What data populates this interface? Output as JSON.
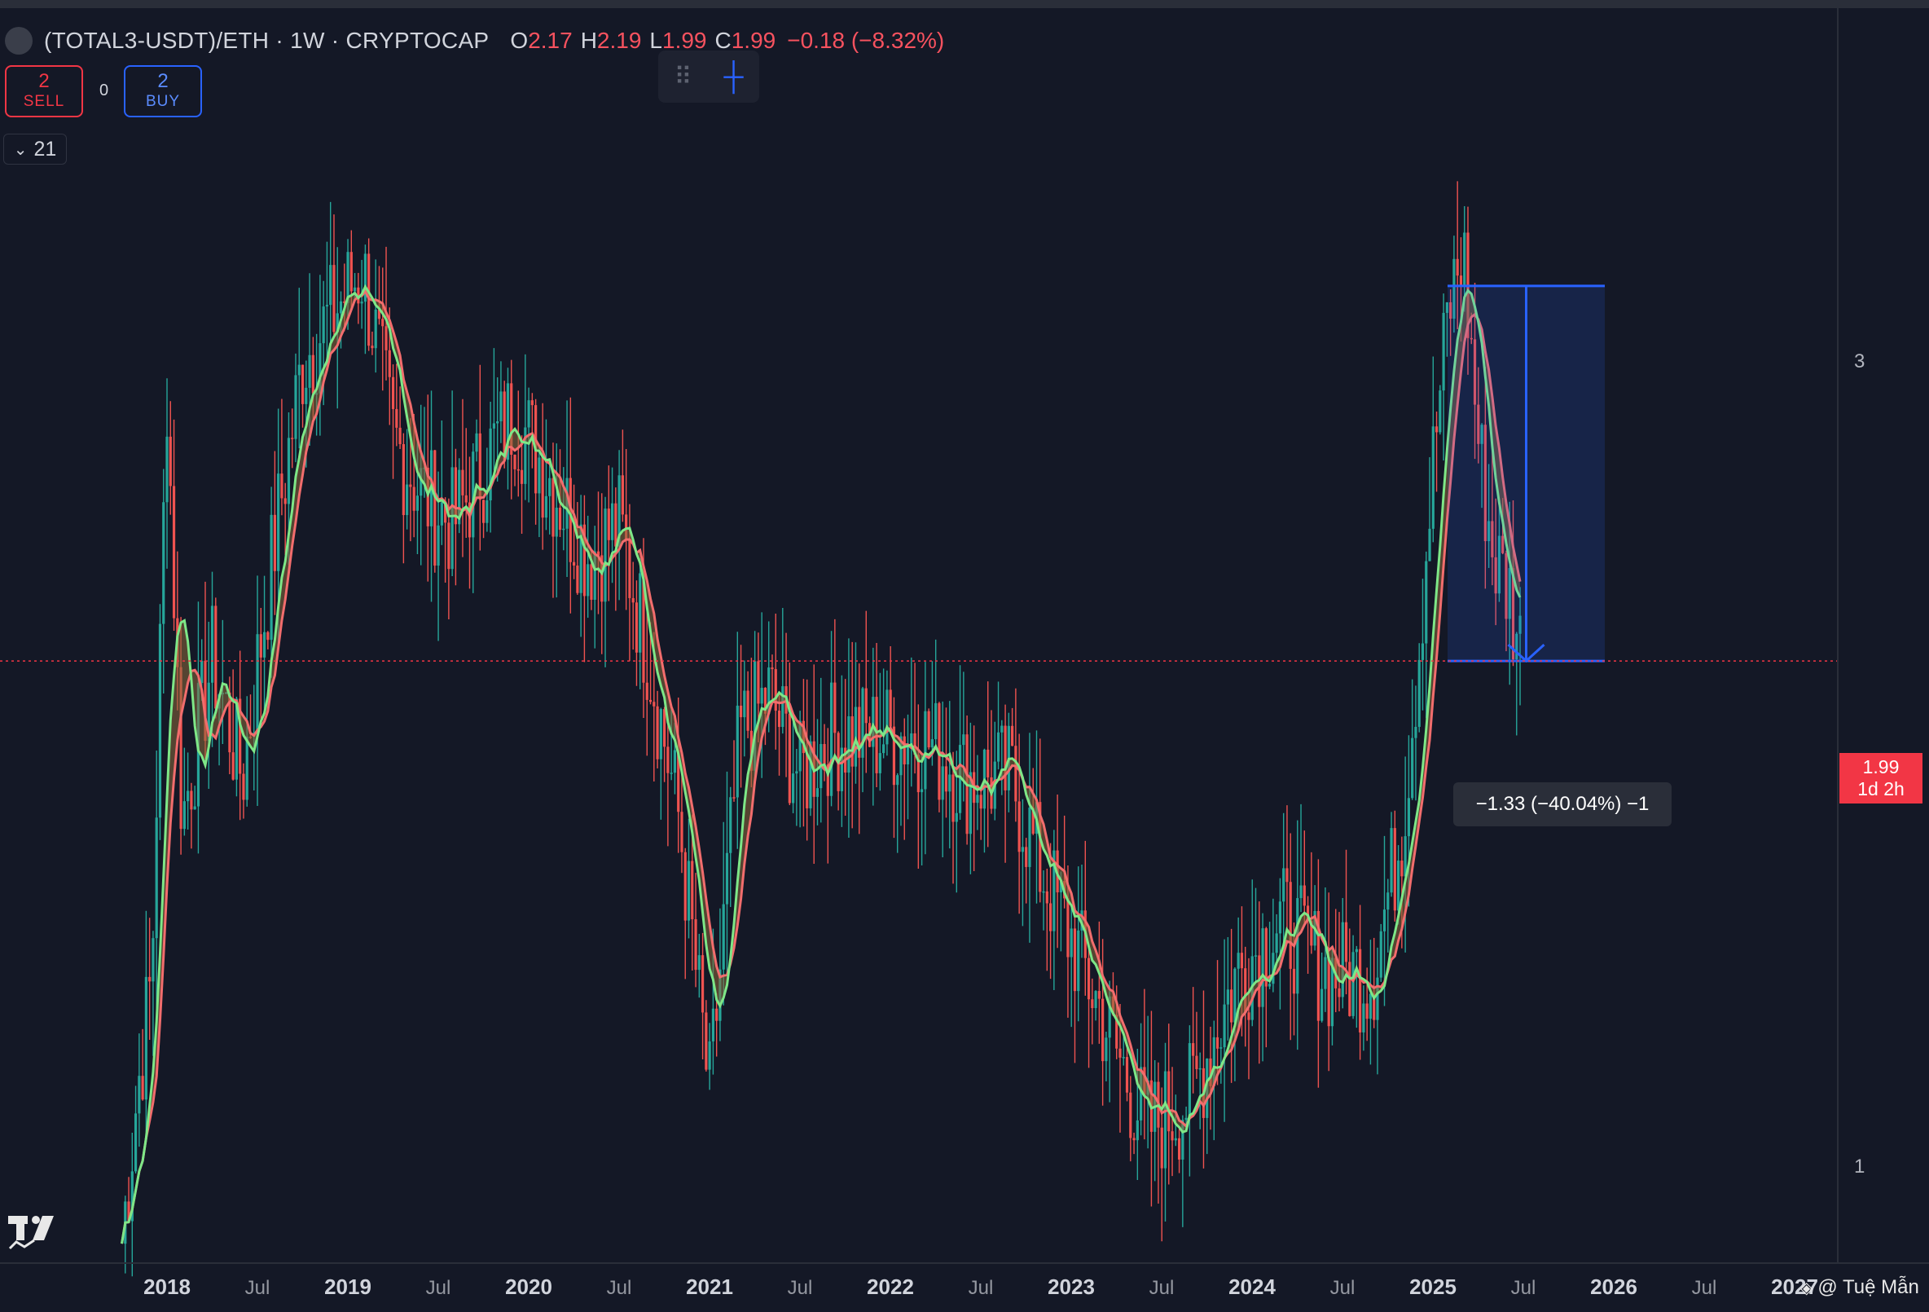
{
  "legend": {
    "symbol": "(TOTAL3-USDT)/ETH · 1W · CRYPTOCAP",
    "open_label": "O",
    "open": "2.17",
    "high_label": "H",
    "high": "2.19",
    "low_label": "L",
    "low": "1.99",
    "close_label": "C",
    "close": "1.99",
    "change": "−0.18 (−8.32%)"
  },
  "trade": {
    "sell_count": "2",
    "sell_label": "SELL",
    "spread": "0",
    "buy_count": "2",
    "buy_label": "BUY"
  },
  "indicators_collapsed": {
    "count": "21"
  },
  "price_tag": {
    "price": "1.99",
    "countdown": "1d 2h"
  },
  "measure": {
    "label": "−1.33 (−40.04%) −1"
  },
  "watermark": {
    "text": "@ Tuệ Mẫn"
  },
  "colors": {
    "background": "#141826",
    "up": "#26a69a",
    "down": "#ef5350",
    "ma_fast": "#7ee787",
    "ma_slow": "#f26d6d",
    "measure": "#2962ff",
    "price_line": "#f23645"
  },
  "chart_data": {
    "type": "candlestick",
    "timeframe": "1W",
    "y_scale": "log",
    "y_ticks": [
      3,
      1
    ],
    "x_ticks": [
      "2018",
      "Jul",
      "2019",
      "Jul",
      "2020",
      "Jul",
      "2021",
      "Jul",
      "2022",
      "Jul",
      "2023",
      "Jul",
      "2024",
      "Jul",
      "2025",
      "Jul",
      "2026",
      "Jul",
      "2027"
    ],
    "current_price": 1.99,
    "approx_closes": [
      {
        "x": "2017-10",
        "y": 0.9
      },
      {
        "x": "2017-11",
        "y": 1.1
      },
      {
        "x": "2017-12",
        "y": 1.3
      },
      {
        "x": "2018-01",
        "y": 2.9
      },
      {
        "x": "2018-02",
        "y": 1.6
      },
      {
        "x": "2018-04",
        "y": 2.0
      },
      {
        "x": "2018-06",
        "y": 1.7
      },
      {
        "x": "2018-08",
        "y": 2.3
      },
      {
        "x": "2018-10",
        "y": 3.0
      },
      {
        "x": "2018-12",
        "y": 3.2
      },
      {
        "x": "2019-02",
        "y": 3.4
      },
      {
        "x": "2019-04",
        "y": 2.7
      },
      {
        "x": "2019-06",
        "y": 2.5
      },
      {
        "x": "2019-08",
        "y": 2.4
      },
      {
        "x": "2019-10",
        "y": 2.6
      },
      {
        "x": "2019-12",
        "y": 2.8
      },
      {
        "x": "2020-02",
        "y": 2.6
      },
      {
        "x": "2020-05",
        "y": 2.3
      },
      {
        "x": "2020-07",
        "y": 2.4
      },
      {
        "x": "2020-09",
        "y": 2.0
      },
      {
        "x": "2020-11",
        "y": 1.6
      },
      {
        "x": "2021-01",
        "y": 1.1
      },
      {
        "x": "2021-03",
        "y": 1.8
      },
      {
        "x": "2021-05",
        "y": 1.9
      },
      {
        "x": "2021-07",
        "y": 1.7
      },
      {
        "x": "2021-09",
        "y": 1.8
      },
      {
        "x": "2021-12",
        "y": 1.8
      },
      {
        "x": "2022-03",
        "y": 1.8
      },
      {
        "x": "2022-06",
        "y": 1.7
      },
      {
        "x": "2022-09",
        "y": 1.7
      },
      {
        "x": "2022-11",
        "y": 1.5
      },
      {
        "x": "2023-02",
        "y": 1.3
      },
      {
        "x": "2023-06",
        "y": 1.05
      },
      {
        "x": "2023-09",
        "y": 1.1
      },
      {
        "x": "2023-12",
        "y": 1.3
      },
      {
        "x": "2024-03",
        "y": 1.4
      },
      {
        "x": "2024-06",
        "y": 1.3
      },
      {
        "x": "2024-09",
        "y": 1.3
      },
      {
        "x": "2024-11",
        "y": 1.6
      },
      {
        "x": "2024-12",
        "y": 2.0
      },
      {
        "x": "2025-01",
        "y": 2.6
      },
      {
        "x": "2025-02",
        "y": 3.2
      },
      {
        "x": "2025-03",
        "y": 3.5
      },
      {
        "x": "2025-04",
        "y": 2.7
      },
      {
        "x": "2025-05",
        "y": 2.3
      },
      {
        "x": "2025-06",
        "y": 2.2
      },
      {
        "x": "2025-07",
        "y": 1.99
      }
    ],
    "measure_tool": {
      "from": 3.32,
      "to": 1.99,
      "change": "−1.33 (−40.04%)"
    }
  }
}
